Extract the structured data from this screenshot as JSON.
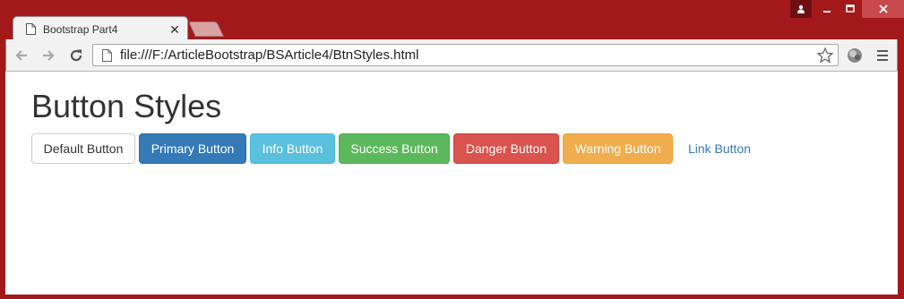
{
  "browser": {
    "tab": {
      "title": "Bootstrap Part4",
      "icon": "document-icon",
      "close_glyph": "✕"
    },
    "address_bar": {
      "url": "file:///F:/ArticleBootstrap/BSArticle4/BtnStyles.html"
    },
    "colors": {
      "frame": "#a3191b",
      "toolbar": "#f2f2f2"
    }
  },
  "page": {
    "heading": "Button Styles",
    "buttons": [
      {
        "label": "Default Button",
        "style": "default",
        "bg": "#ffffff",
        "fg": "#333333"
      },
      {
        "label": "Primary Button",
        "style": "primary",
        "bg": "#337ab7",
        "fg": "#ffffff"
      },
      {
        "label": "Info Button",
        "style": "info",
        "bg": "#5bc0de",
        "fg": "#ffffff"
      },
      {
        "label": "Success Button",
        "style": "success",
        "bg": "#5cb85c",
        "fg": "#ffffff"
      },
      {
        "label": "Danger Button",
        "style": "danger",
        "bg": "#d9534f",
        "fg": "#ffffff"
      },
      {
        "label": "Warning Button",
        "style": "warning",
        "bg": "#f0ad4e",
        "fg": "#ffffff"
      },
      {
        "label": "Link Button",
        "style": "link",
        "bg": "transparent",
        "fg": "#337ab7"
      }
    ]
  }
}
